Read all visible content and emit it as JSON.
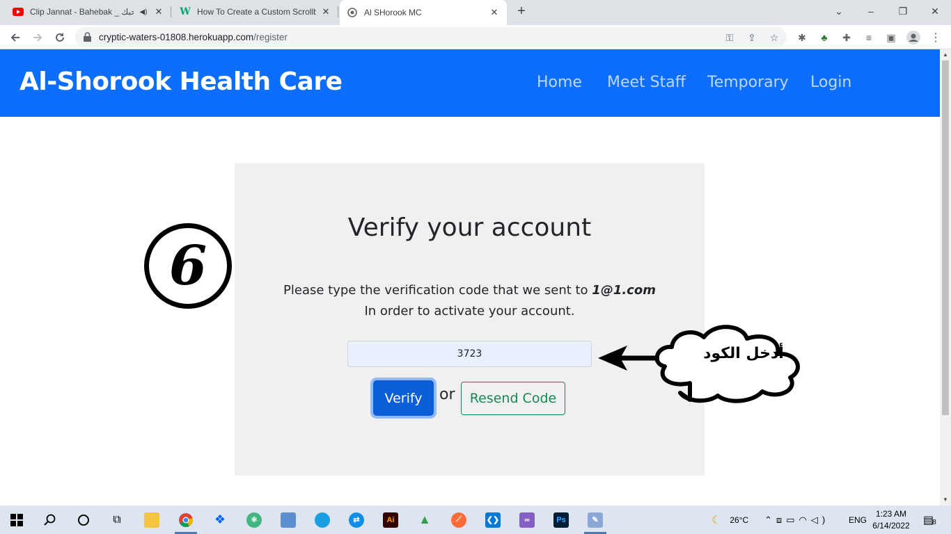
{
  "browser": {
    "tabs": [
      {
        "title": "Clip Jannat - Bahebak _ بحبك",
        "favicon": "youtube-icon",
        "audio": true,
        "active": false
      },
      {
        "title": "How To Create a Custom Scrollba",
        "favicon": "w3-icon",
        "audio": false,
        "active": false
      },
      {
        "title": "Al SHorook MC",
        "favicon": "site-icon",
        "audio": false,
        "active": true
      }
    ],
    "new_tab": "+",
    "url_host": "cryptic-waters-01808.herokuapp.com",
    "url_path": "/register"
  },
  "site": {
    "brand": "Al-Shorook Health Care",
    "nav": [
      "Home",
      "Meet Staff",
      "Temporary",
      "Login"
    ],
    "accent_color": "#0d6efd"
  },
  "verify": {
    "title": "Verify your account",
    "message_prefix": "Please type the verification code that we sent to ",
    "email": "1@1.com",
    "message_line2": "In order to activate your account.",
    "code_value": "3723",
    "verify_label": "Verify",
    "or_text": "or",
    "resend_label": "Resend Code"
  },
  "annotation": {
    "step_number": "6",
    "bubble_text": "أدخل الكود"
  },
  "taskbar": {
    "weather": "26°C",
    "language": "ENG",
    "time": "1:23 AM",
    "date": "6/14/2022",
    "notifications": "8"
  }
}
